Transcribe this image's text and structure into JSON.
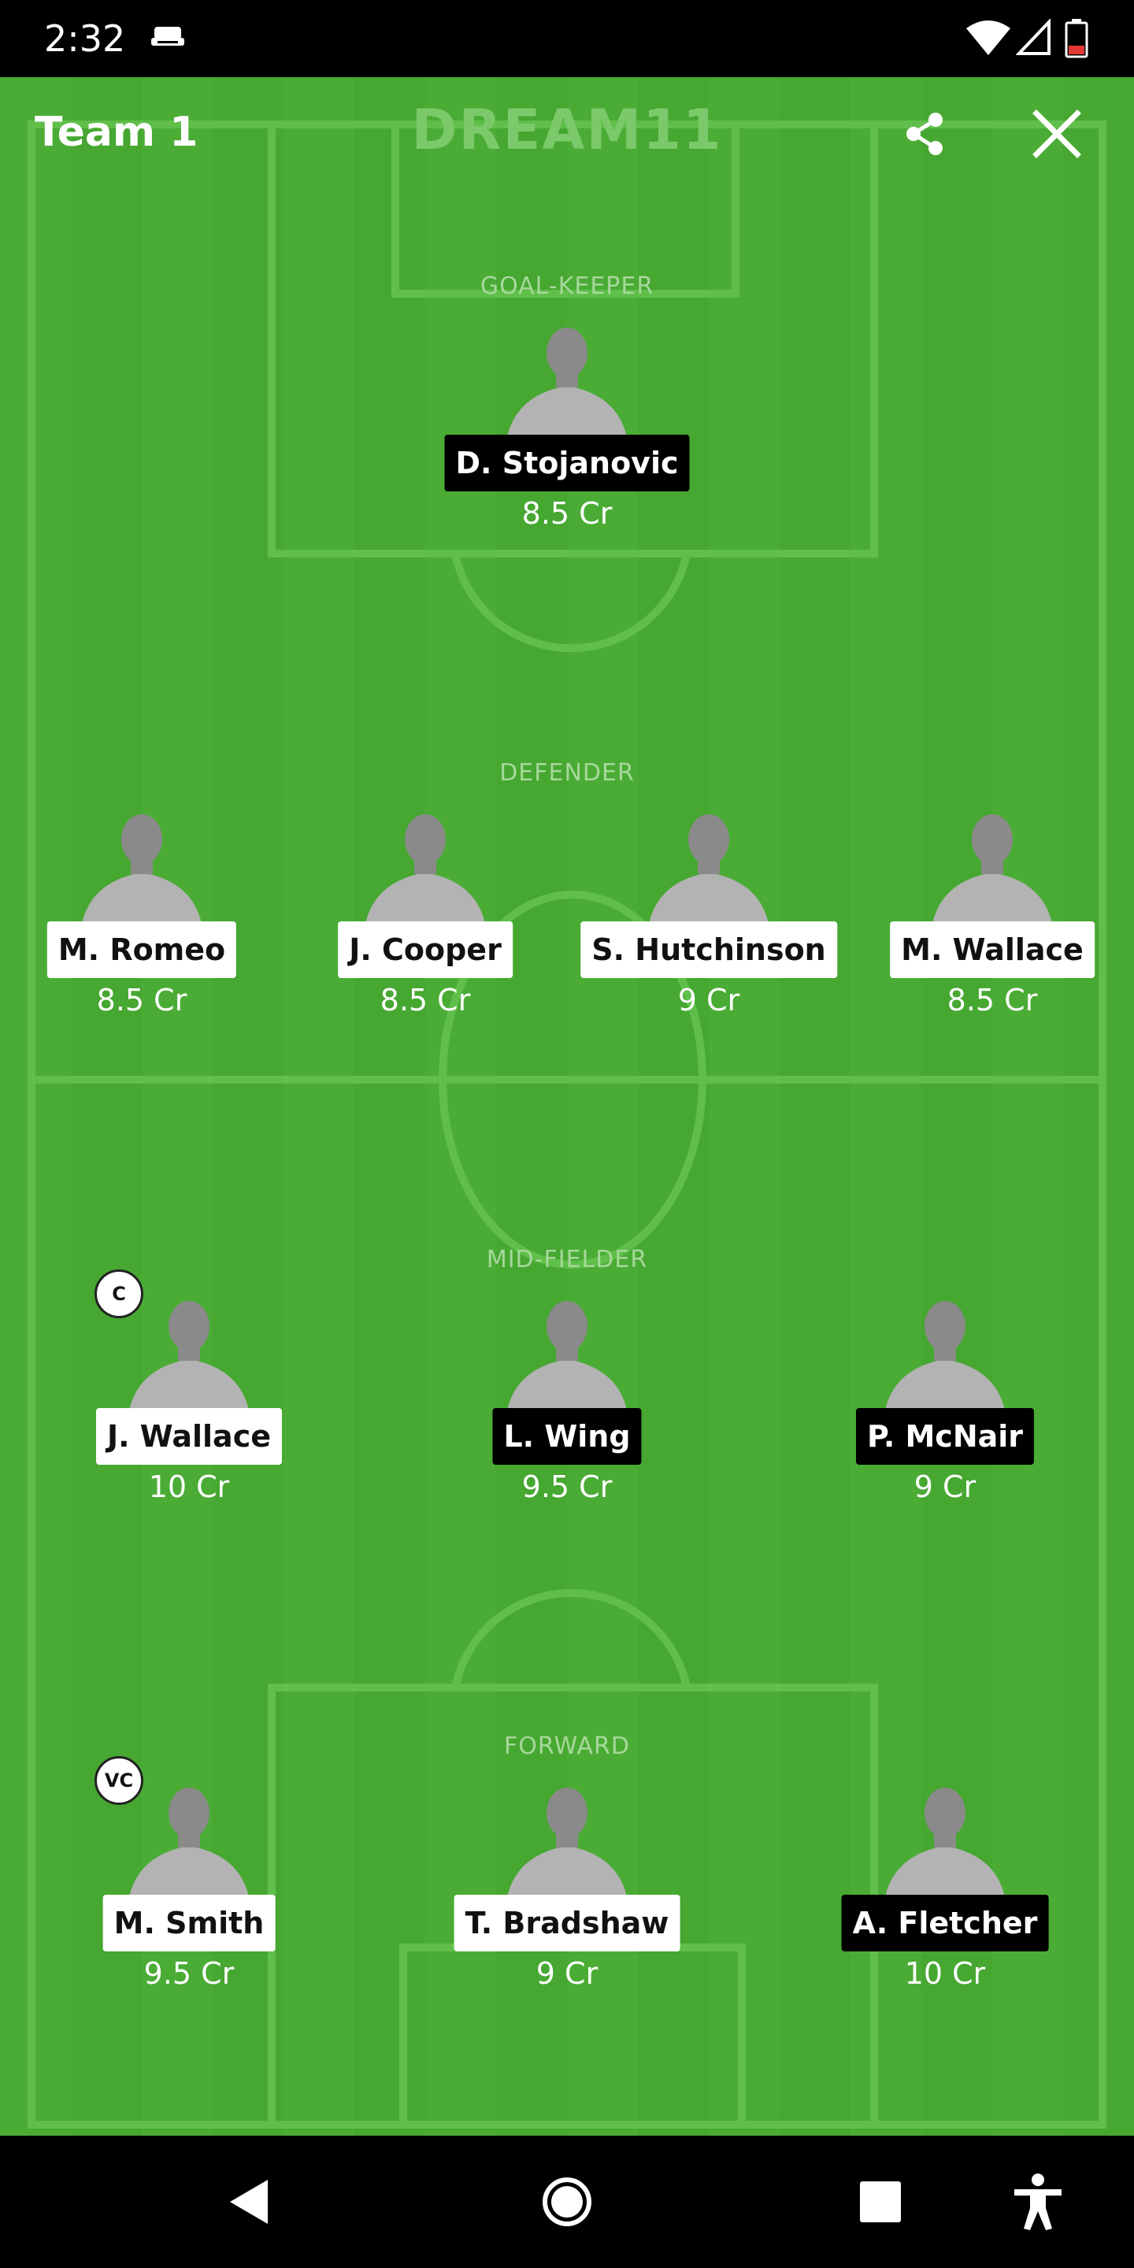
{
  "status_bar": {
    "time": "2:32"
  },
  "header": {
    "title": "Team 1",
    "brand": "DREAM11"
  },
  "positions": {
    "goalkeeper": "GOAL-KEEPER",
    "defender": "DEFENDER",
    "midfielder": "MID-FIELDER",
    "forward": "FORWARD"
  },
  "goalkeeper": [
    {
      "name": "D. Stojanovic",
      "price": "8.5 Cr"
    }
  ],
  "defenders": [
    {
      "name": "M. Romeo",
      "price": "8.5 Cr"
    },
    {
      "name": "J. Cooper",
      "price": "8.5 Cr"
    },
    {
      "name": "S. Hutchinson",
      "price": "9 Cr"
    },
    {
      "name": "M. Wallace",
      "price": "8.5 Cr"
    }
  ],
  "midfielders": [
    {
      "name": "J. Wallace",
      "price": "10 Cr",
      "badge": "C"
    },
    {
      "name": "L. Wing",
      "price": "9.5 Cr"
    },
    {
      "name": "P. McNair",
      "price": "9 Cr"
    }
  ],
  "forwards": [
    {
      "name": "M. Smith",
      "price": "9.5 Cr",
      "badge": "VC"
    },
    {
      "name": "T. Bradshaw",
      "price": "9 Cr"
    },
    {
      "name": "A. Fletcher",
      "price": "10 Cr"
    }
  ],
  "icons": {
    "share": "share-icon",
    "close": "close-icon",
    "back": "back-triangle-icon",
    "home": "home-circle-icon",
    "recents": "recents-square-icon",
    "accessibility": "accessibility-icon"
  },
  "colors": {
    "field_green": "#4aac35",
    "field_stripe": "#46a731",
    "line_green": "#5fbf4a",
    "label_green": "#a6d89a"
  }
}
